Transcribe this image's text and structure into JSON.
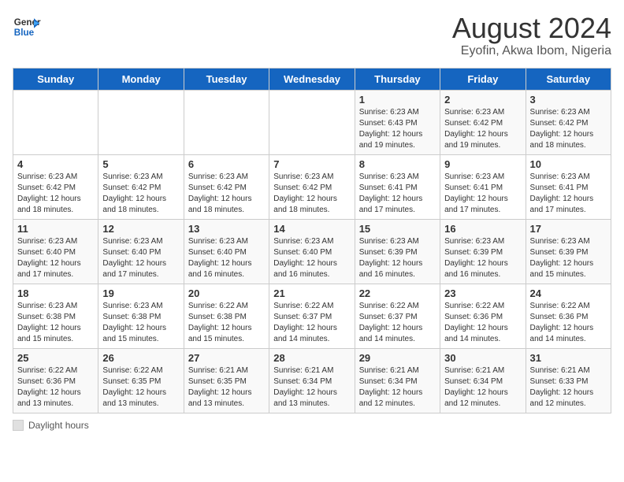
{
  "header": {
    "logo_general": "General",
    "logo_blue": "Blue",
    "title": "August 2024",
    "subtitle": "Eyofin, Akwa Ibom, Nigeria"
  },
  "weekdays": [
    "Sunday",
    "Monday",
    "Tuesday",
    "Wednesday",
    "Thursday",
    "Friday",
    "Saturday"
  ],
  "footer": {
    "label": "Daylight hours"
  },
  "weeks": [
    {
      "days": [
        {
          "num": "",
          "info": ""
        },
        {
          "num": "",
          "info": ""
        },
        {
          "num": "",
          "info": ""
        },
        {
          "num": "",
          "info": ""
        },
        {
          "num": "1",
          "info": "Sunrise: 6:23 AM\nSunset: 6:43 PM\nDaylight: 12 hours\nand 19 minutes."
        },
        {
          "num": "2",
          "info": "Sunrise: 6:23 AM\nSunset: 6:42 PM\nDaylight: 12 hours\nand 19 minutes."
        },
        {
          "num": "3",
          "info": "Sunrise: 6:23 AM\nSunset: 6:42 PM\nDaylight: 12 hours\nand 18 minutes."
        }
      ]
    },
    {
      "days": [
        {
          "num": "4",
          "info": "Sunrise: 6:23 AM\nSunset: 6:42 PM\nDaylight: 12 hours\nand 18 minutes."
        },
        {
          "num": "5",
          "info": "Sunrise: 6:23 AM\nSunset: 6:42 PM\nDaylight: 12 hours\nand 18 minutes."
        },
        {
          "num": "6",
          "info": "Sunrise: 6:23 AM\nSunset: 6:42 PM\nDaylight: 12 hours\nand 18 minutes."
        },
        {
          "num": "7",
          "info": "Sunrise: 6:23 AM\nSunset: 6:42 PM\nDaylight: 12 hours\nand 18 minutes."
        },
        {
          "num": "8",
          "info": "Sunrise: 6:23 AM\nSunset: 6:41 PM\nDaylight: 12 hours\nand 17 minutes."
        },
        {
          "num": "9",
          "info": "Sunrise: 6:23 AM\nSunset: 6:41 PM\nDaylight: 12 hours\nand 17 minutes."
        },
        {
          "num": "10",
          "info": "Sunrise: 6:23 AM\nSunset: 6:41 PM\nDaylight: 12 hours\nand 17 minutes."
        }
      ]
    },
    {
      "days": [
        {
          "num": "11",
          "info": "Sunrise: 6:23 AM\nSunset: 6:40 PM\nDaylight: 12 hours\nand 17 minutes."
        },
        {
          "num": "12",
          "info": "Sunrise: 6:23 AM\nSunset: 6:40 PM\nDaylight: 12 hours\nand 17 minutes."
        },
        {
          "num": "13",
          "info": "Sunrise: 6:23 AM\nSunset: 6:40 PM\nDaylight: 12 hours\nand 16 minutes."
        },
        {
          "num": "14",
          "info": "Sunrise: 6:23 AM\nSunset: 6:40 PM\nDaylight: 12 hours\nand 16 minutes."
        },
        {
          "num": "15",
          "info": "Sunrise: 6:23 AM\nSunset: 6:39 PM\nDaylight: 12 hours\nand 16 minutes."
        },
        {
          "num": "16",
          "info": "Sunrise: 6:23 AM\nSunset: 6:39 PM\nDaylight: 12 hours\nand 16 minutes."
        },
        {
          "num": "17",
          "info": "Sunrise: 6:23 AM\nSunset: 6:39 PM\nDaylight: 12 hours\nand 15 minutes."
        }
      ]
    },
    {
      "days": [
        {
          "num": "18",
          "info": "Sunrise: 6:23 AM\nSunset: 6:38 PM\nDaylight: 12 hours\nand 15 minutes."
        },
        {
          "num": "19",
          "info": "Sunrise: 6:23 AM\nSunset: 6:38 PM\nDaylight: 12 hours\nand 15 minutes."
        },
        {
          "num": "20",
          "info": "Sunrise: 6:22 AM\nSunset: 6:38 PM\nDaylight: 12 hours\nand 15 minutes."
        },
        {
          "num": "21",
          "info": "Sunrise: 6:22 AM\nSunset: 6:37 PM\nDaylight: 12 hours\nand 14 minutes."
        },
        {
          "num": "22",
          "info": "Sunrise: 6:22 AM\nSunset: 6:37 PM\nDaylight: 12 hours\nand 14 minutes."
        },
        {
          "num": "23",
          "info": "Sunrise: 6:22 AM\nSunset: 6:36 PM\nDaylight: 12 hours\nand 14 minutes."
        },
        {
          "num": "24",
          "info": "Sunrise: 6:22 AM\nSunset: 6:36 PM\nDaylight: 12 hours\nand 14 minutes."
        }
      ]
    },
    {
      "days": [
        {
          "num": "25",
          "info": "Sunrise: 6:22 AM\nSunset: 6:36 PM\nDaylight: 12 hours\nand 13 minutes."
        },
        {
          "num": "26",
          "info": "Sunrise: 6:22 AM\nSunset: 6:35 PM\nDaylight: 12 hours\nand 13 minutes."
        },
        {
          "num": "27",
          "info": "Sunrise: 6:21 AM\nSunset: 6:35 PM\nDaylight: 12 hours\nand 13 minutes."
        },
        {
          "num": "28",
          "info": "Sunrise: 6:21 AM\nSunset: 6:34 PM\nDaylight: 12 hours\nand 13 minutes."
        },
        {
          "num": "29",
          "info": "Sunrise: 6:21 AM\nSunset: 6:34 PM\nDaylight: 12 hours\nand 12 minutes."
        },
        {
          "num": "30",
          "info": "Sunrise: 6:21 AM\nSunset: 6:34 PM\nDaylight: 12 hours\nand 12 minutes."
        },
        {
          "num": "31",
          "info": "Sunrise: 6:21 AM\nSunset: 6:33 PM\nDaylight: 12 hours\nand 12 minutes."
        }
      ]
    }
  ]
}
